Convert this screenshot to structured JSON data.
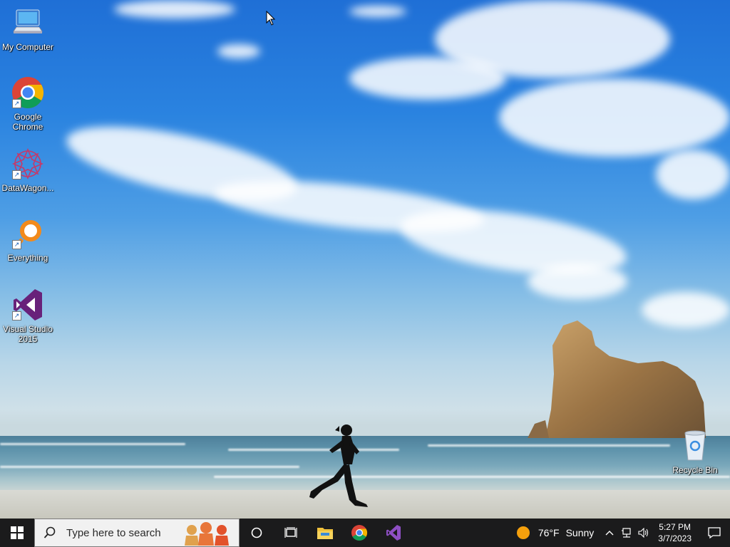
{
  "desktop": {
    "icons": [
      {
        "label": "My Computer",
        "icon": "computer-icon"
      },
      {
        "label": "Google\nChrome",
        "icon": "chrome-icon"
      },
      {
        "label": "DataWagon...",
        "icon": "datawagon-icon"
      },
      {
        "label": "Everything",
        "icon": "everything-icon"
      },
      {
        "label": "Visual Studio\n2015",
        "icon": "visual-studio-icon"
      },
      {
        "label": "Recycle Bin",
        "icon": "recycle-bin-icon"
      }
    ]
  },
  "taskbar": {
    "start_icon": "windows-logo-icon",
    "search_placeholder": "Type here to search",
    "pinned": [
      "cortana-icon",
      "task-view-icon",
      "file-explorer-icon",
      "chrome-icon",
      "visual-studio-icon"
    ],
    "weather": {
      "temp": "76°F",
      "condition": "Sunny",
      "icon": "sun-icon"
    },
    "clock": {
      "time": "5:27 PM",
      "date": "3/7/2023"
    }
  },
  "colors": {
    "taskbar": "#1b1b1c",
    "chrome_red": "#db4437",
    "chrome_green": "#0f9d58",
    "chrome_yellow": "#f4b400",
    "chrome_blue": "#4285f4",
    "vs_purple": "#68217a",
    "everything_orange": "#f28a1b",
    "sun": "#f5a00c"
  }
}
